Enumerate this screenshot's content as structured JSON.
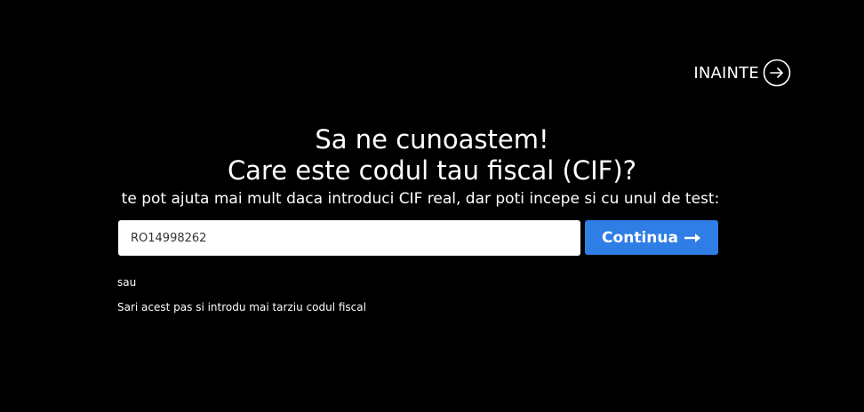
{
  "header": {
    "next_label": "INAINTE",
    "next_icon": "arrow-circle-right-icon"
  },
  "main": {
    "title_line1": "Sa ne cunoastem!",
    "title_line2": "Care este codul tau fiscal (CIF)?",
    "subtitle": "te pot ajuta mai mult daca introduci CIF real, dar poti incepe si cu unul de test:",
    "cif_input": {
      "value": "RO14998262"
    },
    "continue_button": {
      "label": "Continua",
      "icon": "arrow-right-icon",
      "color": "#2f7ee6"
    },
    "or_text": "sau",
    "skip_link": "Sari acest pas si introdu mai tarziu codul fiscal"
  },
  "colors": {
    "background": "#000000",
    "text": "#ffffff",
    "accent": "#2f7ee6"
  }
}
